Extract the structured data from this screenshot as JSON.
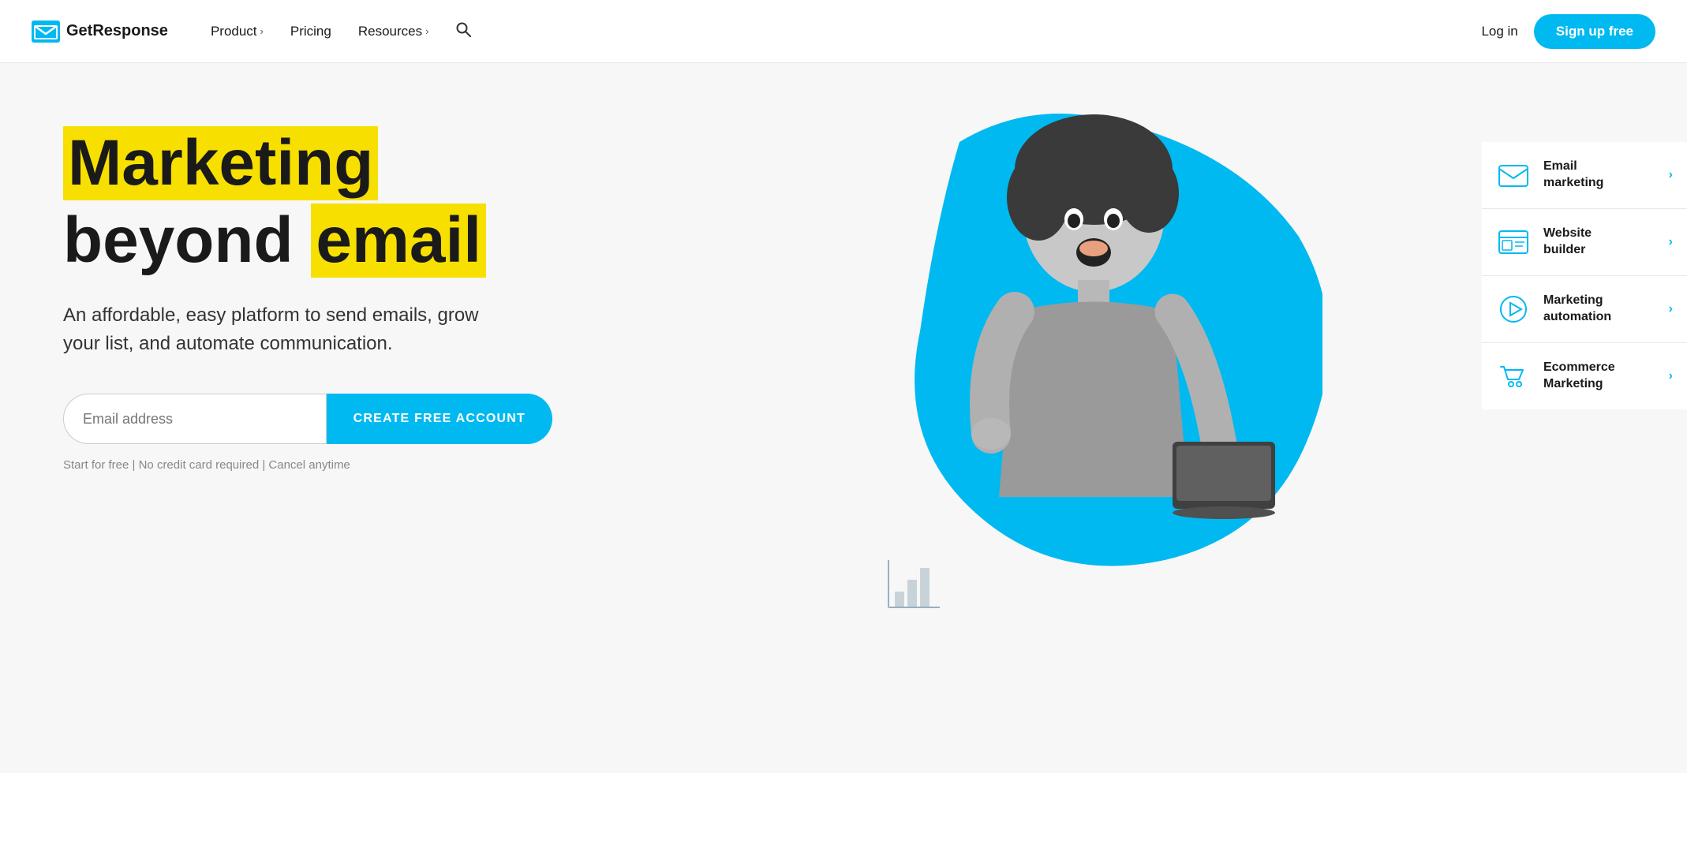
{
  "brand": {
    "name": "GetResponse",
    "logo_alt": "GetResponse logo"
  },
  "navbar": {
    "product_label": "Product",
    "pricing_label": "Pricing",
    "resources_label": "Resources",
    "login_label": "Log in",
    "signup_label": "Sign up free"
  },
  "hero": {
    "heading_line1": "Marketing",
    "heading_line2_plain": "beyond",
    "heading_line2_highlight": "email",
    "subtext": "An affordable, easy platform to send emails, grow your list, and automate communication.",
    "email_placeholder": "Email address",
    "cta_label": "CREATE FREE ACCOUNT",
    "form_note": "Start for free | No credit card required | Cancel anytime"
  },
  "feature_cards": [
    {
      "label": "Email marketing",
      "icon": "email-marketing-icon"
    },
    {
      "label": "Website builder",
      "icon": "website-builder-icon"
    },
    {
      "label": "Marketing automation",
      "icon": "marketing-automation-icon"
    },
    {
      "label": "Ecommerce Marketing",
      "icon": "ecommerce-marketing-icon"
    }
  ],
  "colors": {
    "accent": "#00b9f1",
    "yellow": "#f7e000",
    "dark": "#1a1a1a",
    "gray": "#888888"
  }
}
